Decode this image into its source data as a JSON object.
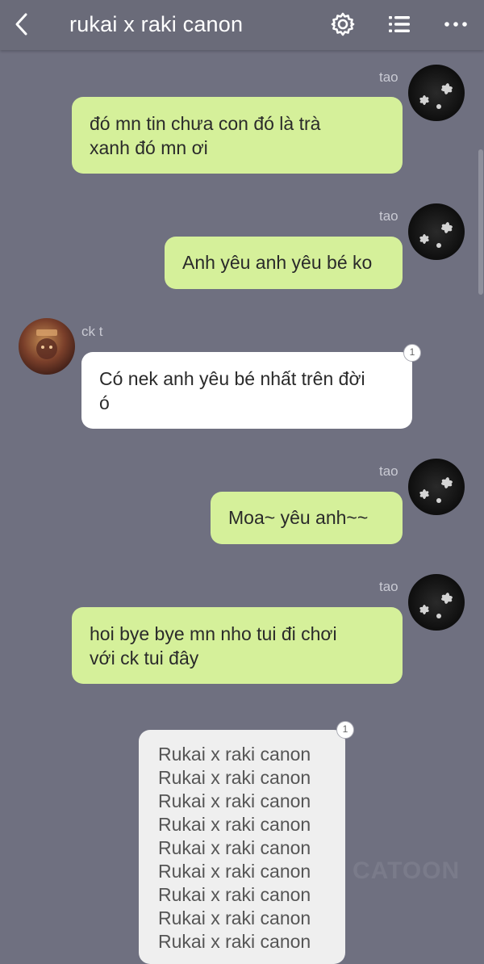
{
  "header": {
    "title": "rukai x raki canon",
    "back_icon": "chevron-left-icon",
    "settings_icon": "gear-icon",
    "list_icon": "list-icon",
    "more_icon": "more-dots-icon"
  },
  "messages": [
    {
      "sender": "tao",
      "side": "right",
      "text_lines": [
        "đó mn tin chưa con đó là trà",
        "xanh đó mn ơi"
      ]
    },
    {
      "sender": "tao",
      "side": "right",
      "text_lines": [
        "Anh yêu anh yêu bé ko"
      ]
    },
    {
      "sender": "ck t",
      "side": "left",
      "text_lines": [
        "Có nek anh yêu bé nhất trên đời",
        "ó"
      ],
      "badge": "1"
    },
    {
      "sender": "tao",
      "side": "right",
      "text_lines": [
        "Moa~ yêu anh~~"
      ]
    },
    {
      "sender": "tao",
      "side": "right",
      "text_lines": [
        "hoi bye bye mn nho tui đi chơi",
        "với ck tui đây"
      ]
    },
    {
      "sender": "",
      "side": "center",
      "badge": "1",
      "text_lines": [
        "Rukai x raki canon",
        "Rukai x raki canon",
        "Rukai x raki canon",
        "Rukai x raki canon",
        "Rukai x raki canon",
        "Rukai x raki canon",
        "Rukai x raki canon",
        "Rukai x raki canon",
        "Rukai x raki canon"
      ]
    }
  ],
  "watermark": "CATOON",
  "colors": {
    "background": "#6f7080",
    "my_bubble": "#d5f09a",
    "their_bubble": "#ffffff",
    "grey_bubble": "#efefef"
  }
}
